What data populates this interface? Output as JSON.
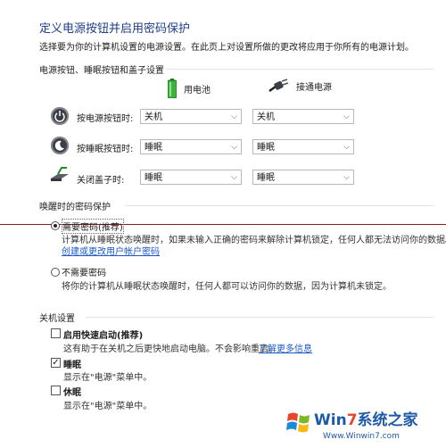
{
  "header": {
    "title": "定义电源按钮并启用密码保护",
    "subtitle": "选择要为你的计算机设置的电源设置。在此页上对设置所做的更改将应用于你所有的电源计划。"
  },
  "buttons_section": {
    "heading": "电源按钮、睡眠按钮和盖子设置",
    "col_battery": "用电池",
    "col_plugged": "接通电源",
    "rows": [
      {
        "label": "按电源按钮时:",
        "battery": "关机",
        "plugged": "关机"
      },
      {
        "label": "按睡眠按钮时:",
        "battery": "睡眠",
        "plugged": "睡眠"
      },
      {
        "label": "关闭盖子时:",
        "battery": "睡眠",
        "plugged": "睡眠"
      }
    ]
  },
  "password_section": {
    "heading": "唤醒时的密码保护",
    "require": {
      "label": "需要密码(推荐)",
      "desc": "计算机从睡眠状态唤醒时，如果未输入正确的密码来解除计算机锁定，任何人都无法访问你的数据。",
      "link": "创建或更改用户帐户密码",
      "selected": true
    },
    "no_require": {
      "label": "不需要密码",
      "desc": "将你的计算机从睡眠状态唤醒时，任何人都可以访问你的数据，因为计算机未锁定。",
      "selected": false
    }
  },
  "shutdown_section": {
    "heading": "关机设置",
    "fast_startup": {
      "label": "启用快速启动(推荐)",
      "desc": "这有助于在关机之后更快地启动电脑。不会影响重启。",
      "link": "了解更多信息",
      "checked": false
    },
    "sleep": {
      "label": "睡眠",
      "desc": "显示在\"电源\"菜单中。",
      "checked": true
    },
    "hibernate": {
      "label": "休眠",
      "desc": "显示在\"电源\"菜单中。",
      "checked": false
    }
  },
  "watermark": {
    "brand_prefix": "Win",
    "brand_digit": "7",
    "brand_cn": "系统之家",
    "url": "Www.Winwin7.com"
  },
  "colors": {
    "title": "#1f3f8a",
    "link": "#1a58c7",
    "red_line": "#8a1a1a"
  }
}
